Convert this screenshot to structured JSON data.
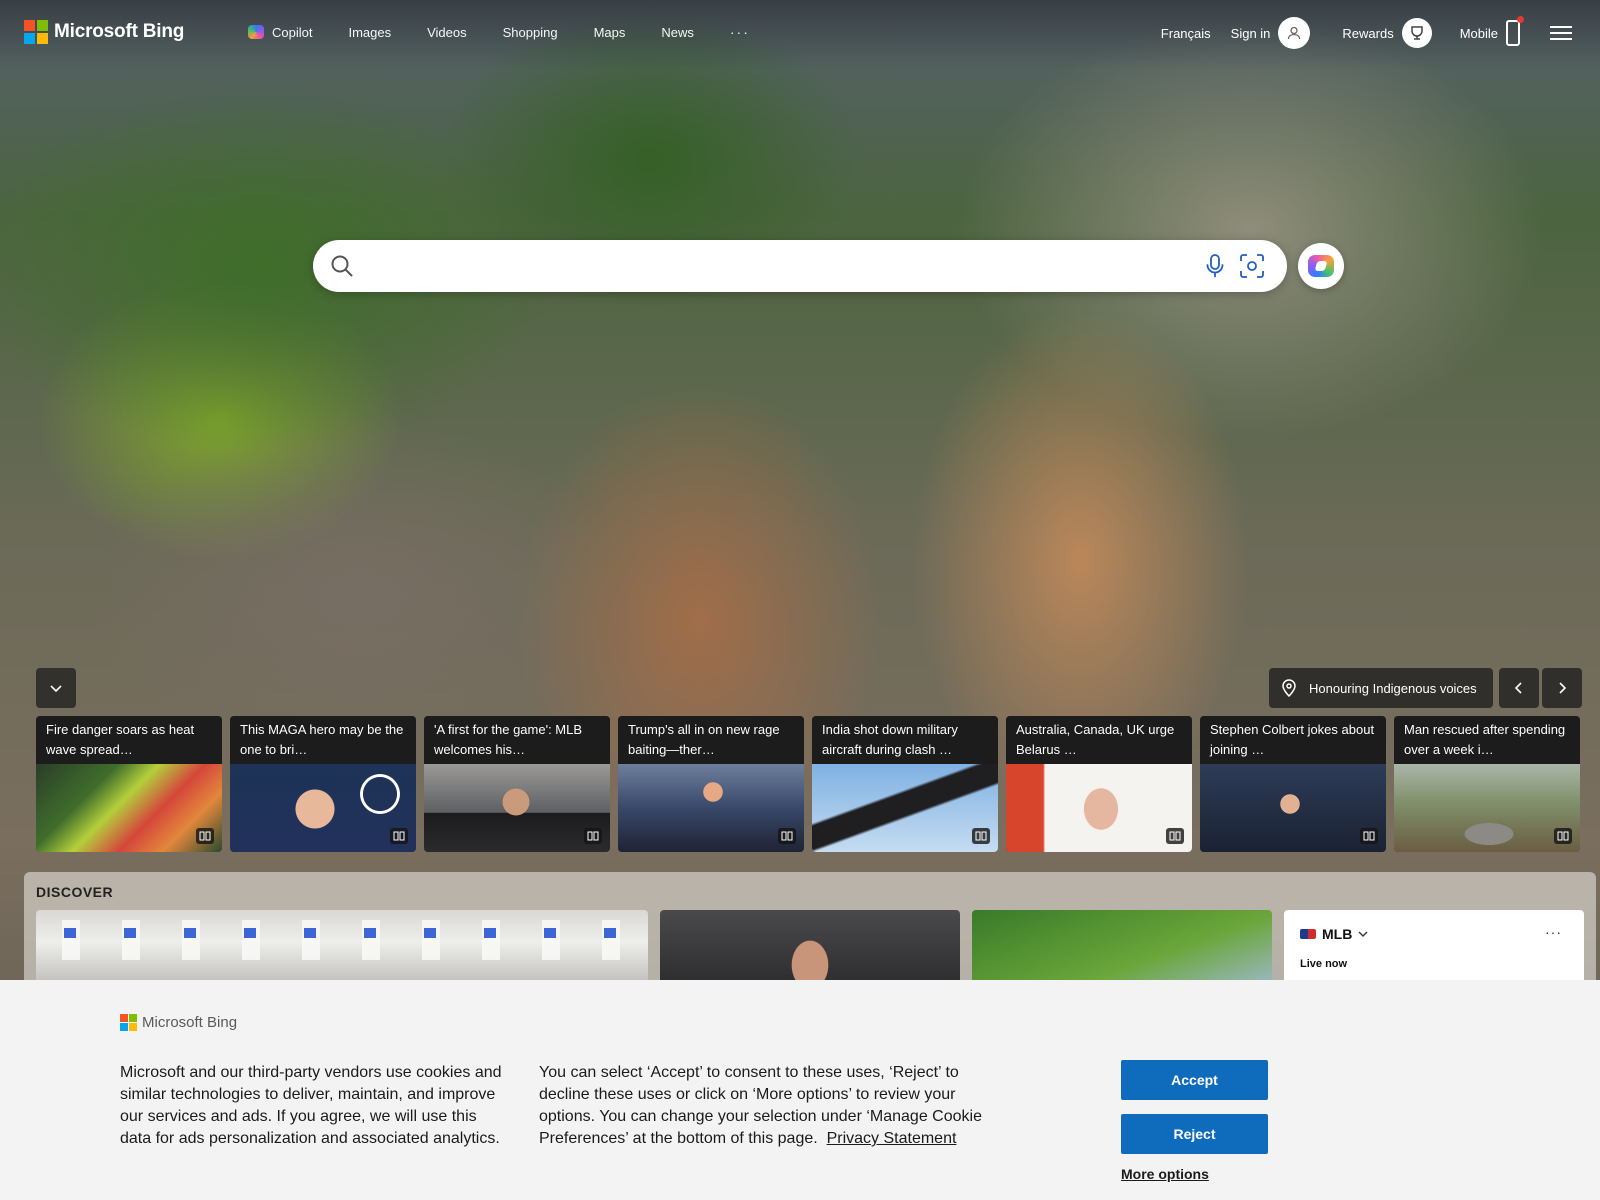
{
  "header": {
    "brand": "Microsoft Bing",
    "nav": [
      {
        "label": "Copilot",
        "icon": "copilot-icon"
      },
      {
        "label": "Images"
      },
      {
        "label": "Videos"
      },
      {
        "label": "Shopping"
      },
      {
        "label": "Maps"
      },
      {
        "label": "News"
      },
      {
        "label": "···"
      }
    ],
    "language": "Français",
    "sign_in": "Sign in",
    "rewards": "Rewards",
    "mobile": "Mobile"
  },
  "search": {
    "value": "",
    "placeholder": ""
  },
  "feed": {
    "topic_pill": "Honouring Indigenous voices",
    "cards": [
      {
        "caption": "Fire danger soars as heat wave spread…"
      },
      {
        "caption": "This MAGA hero may be the one to bri…"
      },
      {
        "caption": "'A first for the game': MLB welcomes his…"
      },
      {
        "caption": "Trump's all in on new rage baiting—ther…"
      },
      {
        "caption": "India shot down military aircraft during clash …"
      },
      {
        "caption": "Australia, Canada, UK urge Belarus …"
      },
      {
        "caption": "Stephen Colbert jokes about joining …"
      },
      {
        "caption": "Man rescued after spending over a week i…"
      }
    ]
  },
  "discover": {
    "title": "DISCOVER",
    "mlb": {
      "title": "MLB",
      "more": "···",
      "status": "Live now"
    }
  },
  "cookie": {
    "brand": "Microsoft Bing",
    "text1": "Microsoft and our third-party vendors use cookies and similar technologies to deliver, maintain, and improve our services and ads. If you agree, we will use this data for ads personalization and associated analytics.",
    "text2": "You can select ‘Accept’ to consent to these uses, ‘Reject’ to decline these uses or click on ‘More options’ to review your options. You can change your selection under ‘Manage Cookie Preferences’ at the bottom of this page.",
    "privacy_link": "Privacy Statement",
    "accept": "Accept",
    "reject": "Reject",
    "more_options": "More options"
  },
  "colors": {
    "button_blue": "#0f6cbd",
    "cookie_bg": "#f3f3f3",
    "notification_dot": "#e33b2e"
  }
}
